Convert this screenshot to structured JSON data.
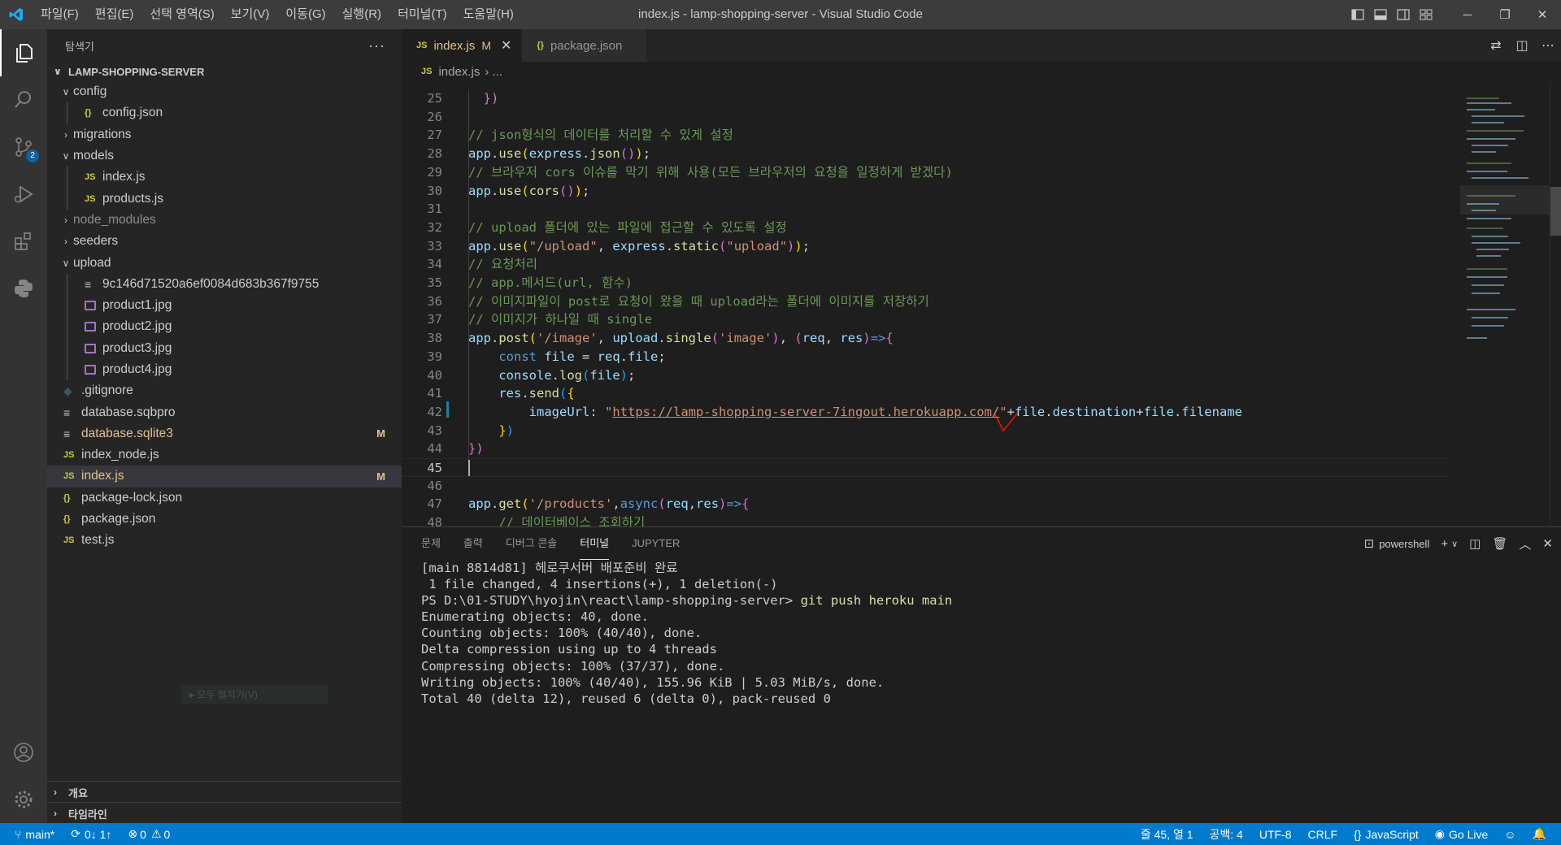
{
  "window": {
    "title": "index.js - lamp-shopping-server - Visual Studio Code",
    "menu": [
      "파일(F)",
      "편집(E)",
      "선택 영역(S)",
      "보기(V)",
      "이동(G)",
      "실행(R)",
      "터미널(T)",
      "도움말(H)"
    ]
  },
  "activity": {
    "scm_badge": "2"
  },
  "sidebar": {
    "header": "탐색기",
    "more": "···",
    "project": "LAMP-SHOPPING-SERVER",
    "tree": [
      {
        "label": "config",
        "chev": "∨",
        "icon": "",
        "depth": 0
      },
      {
        "label": "config.json",
        "chev": "",
        "icon": "{}",
        "depth": 1
      },
      {
        "label": "migrations",
        "chev": "›",
        "icon": "",
        "depth": 0
      },
      {
        "label": "models",
        "chev": "∨",
        "icon": "",
        "depth": 0
      },
      {
        "label": "index.js",
        "chev": "",
        "icon": "JS",
        "depth": 1
      },
      {
        "label": "products.js",
        "chev": "",
        "icon": "JS",
        "depth": 1
      },
      {
        "label": "node_modules",
        "chev": "›",
        "icon": "",
        "depth": 0
      },
      {
        "label": "seeders",
        "chev": "›",
        "icon": "",
        "depth": 0
      },
      {
        "label": "upload",
        "chev": "∨",
        "icon": "",
        "depth": 0
      },
      {
        "label": "9c146d71520a6ef0084d683b367f9755",
        "chev": "",
        "icon": "≡",
        "depth": 1
      },
      {
        "label": "product1.jpg",
        "chev": "",
        "icon": "img",
        "depth": 1
      },
      {
        "label": "product2.jpg",
        "chev": "",
        "icon": "img",
        "depth": 1
      },
      {
        "label": "product3.jpg",
        "chev": "",
        "icon": "img",
        "depth": 1
      },
      {
        "label": "product4.jpg",
        "chev": "",
        "icon": "img",
        "depth": 1
      },
      {
        "label": ".gitignore",
        "chev": "",
        "icon": "◆",
        "depth": 0
      },
      {
        "label": "database.sqbpro",
        "chev": "",
        "icon": "≡",
        "depth": 0
      },
      {
        "label": "database.sqlite3",
        "chev": "",
        "icon": "≡",
        "depth": 0,
        "badge": "M"
      },
      {
        "label": "index_node.js",
        "chev": "",
        "icon": "JS",
        "depth": 0
      },
      {
        "label": "index.js",
        "chev": "",
        "icon": "JS",
        "depth": 0,
        "badge": "M"
      },
      {
        "label": "package-lock.json",
        "chev": "",
        "icon": "{}",
        "depth": 0
      },
      {
        "label": "package.json",
        "chev": "",
        "icon": "{}",
        "depth": 0
      },
      {
        "label": "test.js",
        "chev": "",
        "icon": "JS",
        "depth": 0
      }
    ],
    "ghost_text": "▸ 모두 펼치기(V)",
    "outline_title": "개요",
    "timeline_title": "타임라인"
  },
  "editor": {
    "tabs": [
      {
        "icon": "JS",
        "label": "index.js",
        "modified": "M",
        "close": "✕"
      },
      {
        "icon": "{}",
        "label": "package.json"
      }
    ],
    "breadcrumb": {
      "icon": "JS",
      "file": "index.js",
      "rest": "›  ..."
    },
    "lines": [
      {
        "n": "25",
        "segs": [
          [
            "c-pun",
            "  "
          ],
          [
            "c-br2",
            "})"
          ]
        ]
      },
      {
        "n": "26",
        "segs": []
      },
      {
        "n": "27",
        "segs": [
          [
            "c-com",
            "// json형식의 데이터를 처리할 수 있게 설정"
          ]
        ]
      },
      {
        "n": "28",
        "segs": [
          [
            "c-var",
            "app"
          ],
          [
            "c-pun",
            "."
          ],
          [
            "c-fn",
            "use"
          ],
          [
            "c-br1",
            "("
          ],
          [
            "c-var",
            "express"
          ],
          [
            "c-pun",
            "."
          ],
          [
            "c-fn",
            "json"
          ],
          [
            "c-br2",
            "()"
          ],
          [
            "c-br1",
            ")"
          ],
          [
            "c-pun",
            ";"
          ]
        ]
      },
      {
        "n": "29",
        "segs": [
          [
            "c-com",
            "// 브라우저 cors 이슈를 막기 위해 사용(모든 브라우저의 요청을 일정하게 받겠다)"
          ]
        ]
      },
      {
        "n": "30",
        "segs": [
          [
            "c-var",
            "app"
          ],
          [
            "c-pun",
            "."
          ],
          [
            "c-fn",
            "use"
          ],
          [
            "c-br1",
            "("
          ],
          [
            "c-fn",
            "cors"
          ],
          [
            "c-br2",
            "()"
          ],
          [
            "c-br1",
            ")"
          ],
          [
            "c-pun",
            ";"
          ]
        ]
      },
      {
        "n": "31",
        "segs": []
      },
      {
        "n": "32",
        "segs": [
          [
            "c-com",
            "// upload 폴더에 있는 파일에 접근할 수 있도록 설정"
          ]
        ]
      },
      {
        "n": "33",
        "segs": [
          [
            "c-var",
            "app"
          ],
          [
            "c-pun",
            "."
          ],
          [
            "c-fn",
            "use"
          ],
          [
            "c-br1",
            "("
          ],
          [
            "c-str",
            "\"/upload\""
          ],
          [
            "c-pun",
            ", "
          ],
          [
            "c-var",
            "express"
          ],
          [
            "c-pun",
            "."
          ],
          [
            "c-fn",
            "static"
          ],
          [
            "c-br2",
            "("
          ],
          [
            "c-str",
            "\"upload\""
          ],
          [
            "c-br2",
            ")"
          ],
          [
            "c-br1",
            ")"
          ],
          [
            "c-pun",
            ";"
          ]
        ]
      },
      {
        "n": "34",
        "segs": [
          [
            "c-com",
            "// 요청처리"
          ]
        ]
      },
      {
        "n": "35",
        "segs": [
          [
            "c-com",
            "// app.메서드(url, 함수)"
          ]
        ]
      },
      {
        "n": "36",
        "segs": [
          [
            "c-com",
            "// 이미지파일이 post로 요청이 왔을 때 upload라는 폴더에 이미지를 저장하기"
          ]
        ]
      },
      {
        "n": "37",
        "segs": [
          [
            "c-com",
            "// 이미지가 하나일 때 single"
          ]
        ]
      },
      {
        "n": "38",
        "segs": [
          [
            "c-var",
            "app"
          ],
          [
            "c-pun",
            "."
          ],
          [
            "c-fn",
            "post"
          ],
          [
            "c-br1",
            "("
          ],
          [
            "c-str",
            "'/image'"
          ],
          [
            "c-pun",
            ", "
          ],
          [
            "c-var",
            "upload"
          ],
          [
            "c-pun",
            "."
          ],
          [
            "c-fn",
            "single"
          ],
          [
            "c-br2",
            "("
          ],
          [
            "c-str",
            "'image'"
          ],
          [
            "c-br2",
            ")"
          ],
          [
            "c-pun",
            ", "
          ],
          [
            "c-br2",
            "("
          ],
          [
            "c-var",
            "req"
          ],
          [
            "c-pun",
            ", "
          ],
          [
            "c-var",
            "res"
          ],
          [
            "c-br2",
            ")"
          ],
          [
            "c-kw",
            "=>"
          ],
          [
            "c-br2",
            "{"
          ]
        ]
      },
      {
        "n": "39",
        "segs": [
          [
            "c-pun",
            "    "
          ],
          [
            "c-kw",
            "const"
          ],
          [
            "c-pun",
            " "
          ],
          [
            "c-var",
            "file"
          ],
          [
            "c-pun",
            " = "
          ],
          [
            "c-var",
            "req"
          ],
          [
            "c-pun",
            "."
          ],
          [
            "c-var",
            "file"
          ],
          [
            "c-pun",
            ";"
          ]
        ]
      },
      {
        "n": "40",
        "segs": [
          [
            "c-pun",
            "    "
          ],
          [
            "c-var",
            "console"
          ],
          [
            "c-pun",
            "."
          ],
          [
            "c-fn",
            "log"
          ],
          [
            "c-br3",
            "("
          ],
          [
            "c-var",
            "file"
          ],
          [
            "c-br3",
            ")"
          ],
          [
            "c-pun",
            ";"
          ]
        ]
      },
      {
        "n": "41",
        "segs": [
          [
            "c-pun",
            "    "
          ],
          [
            "c-var",
            "res"
          ],
          [
            "c-pun",
            "."
          ],
          [
            "c-fn",
            "send"
          ],
          [
            "c-br3",
            "("
          ],
          [
            "c-br1",
            "{"
          ]
        ]
      },
      {
        "n": "42",
        "segs": [
          [
            "c-pun",
            "        "
          ],
          [
            "c-var",
            "imageUrl"
          ],
          [
            "c-pun",
            ": "
          ],
          [
            "c-str",
            "\""
          ],
          [
            "c-url",
            "https://lamp-shopping-server-7ingout.herokuapp.com/"
          ],
          [
            "c-str",
            "\""
          ],
          [
            "c-pun",
            "+"
          ],
          [
            "c-var",
            "file"
          ],
          [
            "c-pun",
            "."
          ],
          [
            "c-var",
            "destination"
          ],
          [
            "c-pun",
            "+"
          ],
          [
            "c-var",
            "file"
          ],
          [
            "c-pun",
            "."
          ],
          [
            "c-var",
            "filename"
          ]
        ]
      },
      {
        "n": "43",
        "segs": [
          [
            "c-pun",
            "    "
          ],
          [
            "c-br1",
            "}"
          ],
          [
            "c-br3",
            ")"
          ]
        ]
      },
      {
        "n": "44",
        "segs": [
          [
            "c-br2",
            "})"
          ]
        ]
      },
      {
        "n": "45",
        "segs": [],
        "current": true
      },
      {
        "n": "46",
        "segs": []
      },
      {
        "n": "47",
        "segs": [
          [
            "c-var",
            "app"
          ],
          [
            "c-pun",
            "."
          ],
          [
            "c-fn",
            "get"
          ],
          [
            "c-br1",
            "("
          ],
          [
            "c-str",
            "'/products'"
          ],
          [
            "c-pun",
            ","
          ],
          [
            "c-kw",
            "async"
          ],
          [
            "c-br2",
            "("
          ],
          [
            "c-var",
            "req"
          ],
          [
            "c-pun",
            ","
          ],
          [
            "c-var",
            "res"
          ],
          [
            "c-br2",
            ")"
          ],
          [
            "c-kw",
            "=>"
          ],
          [
            "c-br2",
            "{"
          ]
        ]
      },
      {
        "n": "48",
        "segs": [
          [
            "c-pun",
            "    "
          ],
          [
            "c-com",
            "// 데이터베이스 조회하기"
          ]
        ]
      }
    ]
  },
  "panel": {
    "tabs": [
      "문제",
      "출력",
      "디버그 콘솔",
      "터미널",
      "JUPYTER"
    ],
    "active_tab": "터미널",
    "shell": "powershell",
    "terminal": [
      {
        "text": "[main 8814d81] 헤로쿠서버 배포준비 완료"
      },
      {
        "text": " 1 file changed, 4 insertions(+), 1 deletion(-)"
      },
      {
        "prompt": "PS D:\\01-STUDY\\hyojin\\react\\lamp-shopping-server> ",
        "cmd": "git push heroku main"
      },
      {
        "text": "Enumerating objects: 40, done."
      },
      {
        "text": "Counting objects: 100% (40/40), done."
      },
      {
        "text": "Delta compression using up to 4 threads"
      },
      {
        "text": "Compressing objects: 100% (37/37), done."
      },
      {
        "text": "Writing objects: 100% (40/40), 155.96 KiB | 5.03 MiB/s, done."
      },
      {
        "text": "Total 40 (delta 12), reused 6 (delta 0), pack-reused 0"
      }
    ]
  },
  "status": {
    "branch": "main*",
    "sync": "0↓ 1↑",
    "problems": "0",
    "warnings": "0",
    "position": "줄 45, 열 1",
    "indent": "공백: 4",
    "encoding": "UTF-8",
    "eol": "CRLF",
    "language": "JavaScript",
    "golive": "Go Live"
  },
  "colors": {
    "accent": "#007acc",
    "modified": "#e2c08d",
    "annotation": "#e51400"
  }
}
